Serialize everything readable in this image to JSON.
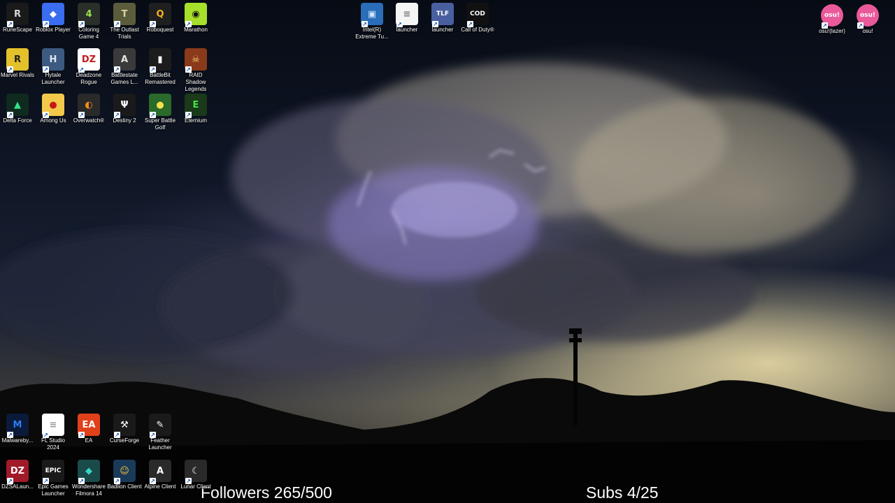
{
  "desktop": {
    "wallpaper": "storm-cloud-lightning",
    "icons_top_left": [
      {
        "name": "RuneScape",
        "bg": "#1a1a1a",
        "fg": "#d8d8d8",
        "glyph": "R",
        "icon": "runescape-icon"
      },
      {
        "name": "Roblox Player",
        "bg": "#3a6df0",
        "fg": "#ffffff",
        "glyph": "◆",
        "icon": "roblox-icon"
      },
      {
        "name": "Coloring Game 4",
        "bg": "#2a2f2a",
        "fg": "#9be04b",
        "glyph": "4",
        "icon": "coloring-game-icon"
      },
      {
        "name": "The Outlast Trials",
        "bg": "#5b5c3b",
        "fg": "#d9d3a0",
        "glyph": "T",
        "icon": "outlast-trials-icon"
      },
      {
        "name": "Roboquest",
        "bg": "#1f1f1f",
        "fg": "#f5b321",
        "glyph": "Q",
        "icon": "roboquest-icon"
      },
      {
        "name": "Marathon",
        "bg": "#a6e02a",
        "fg": "#111111",
        "glyph": "◉",
        "icon": "marathon-icon"
      },
      {
        "name": "Marvel Rivals",
        "bg": "#e3c12a",
        "fg": "#1a1a1a",
        "glyph": "R",
        "icon": "marvel-rivals-icon"
      },
      {
        "name": "Hytale Launcher",
        "bg": "#3d5a80",
        "fg": "#dfe7f5",
        "glyph": "H",
        "icon": "hytale-icon"
      },
      {
        "name": "Deadzone Rogue",
        "bg": "#ffffff",
        "fg": "#c01a1a",
        "glyph": "DZ",
        "icon": "deadzone-rogue-icon"
      },
      {
        "name": "Battlestate Games L...",
        "bg": "#3a3a3a",
        "fg": "#e5e5e5",
        "glyph": "A",
        "icon": "battlestate-icon"
      },
      {
        "name": "BattleBit Remastered",
        "bg": "#1c1c1c",
        "fg": "#ffffff",
        "glyph": "▮",
        "icon": "battlebit-icon"
      },
      {
        "name": "RAID Shadow Legends",
        "bg": "#8a3a1a",
        "fg": "#f2c46b",
        "glyph": "☠",
        "icon": "raid-shadow-legends-icon"
      },
      {
        "name": "Delta Force",
        "bg": "#0f2a1f",
        "fg": "#35e28a",
        "glyph": "▲",
        "icon": "delta-force-icon"
      },
      {
        "name": "Among Us",
        "bg": "#f3c94a",
        "fg": "#c41a1a",
        "glyph": "●",
        "icon": "among-us-icon"
      },
      {
        "name": "Overwatch®",
        "bg": "#2a2a2a",
        "fg": "#f28c1c",
        "glyph": "◐",
        "icon": "overwatch-icon"
      },
      {
        "name": "Destiny 2",
        "bg": "#1a1a1a",
        "fg": "#ffffff",
        "glyph": "Ψ",
        "icon": "destiny-2-icon"
      },
      {
        "name": "Super Battle Golf",
        "bg": "#2a6a2a",
        "fg": "#f6e24a",
        "glyph": "●",
        "icon": "super-battle-golf-icon"
      },
      {
        "name": "Eternium",
        "bg": "#1a3a1a",
        "fg": "#45e34a",
        "glyph": "E",
        "icon": "eternium-icon"
      }
    ],
    "icons_top_center": [
      {
        "name": "Intel(R) Extreme Tu...",
        "bg": "#2a6db8",
        "fg": "#cfe6ff",
        "glyph": "▣",
        "icon": "intel-xtu-icon"
      },
      {
        "name": "launcher",
        "bg": "#f4f4f4",
        "fg": "#7a7a7a",
        "glyph": "≡",
        "icon": "file-icon"
      },
      {
        "name": "launcher",
        "bg": "#4a5fa0",
        "fg": "#ffffff",
        "glyph": "TLF",
        "icon": "tlf-launcher-icon"
      },
      {
        "name": "Call of Duty®",
        "bg": "#111111",
        "fg": "#ffffff",
        "glyph": "COD",
        "icon": "call-of-duty-icon"
      }
    ],
    "icons_top_right": [
      {
        "name": "osu!(lazer)",
        "bg": "#ea5a9a",
        "fg": "#ffffff",
        "glyph": "osu!",
        "icon": "osu-lazer-icon"
      },
      {
        "name": "osu!",
        "bg": "#ea5a9a",
        "fg": "#ffffff",
        "glyph": "osu!",
        "icon": "osu-icon"
      }
    ],
    "icons_bottom_left": [
      {
        "name": "Malwareby...",
        "bg": "#0b1a3a",
        "fg": "#2a7cf0",
        "glyph": "M",
        "icon": "malwarebytes-icon"
      },
      {
        "name": "FL Studio 2024",
        "bg": "#ffffff",
        "fg": "#9a9a9a",
        "glyph": "≡",
        "icon": "fl-studio-icon"
      },
      {
        "name": "EA",
        "bg": "#e0401a",
        "fg": "#ffffff",
        "glyph": "EA",
        "icon": "ea-icon"
      },
      {
        "name": "CurseForge",
        "bg": "#1a1a1a",
        "fg": "#ffffff",
        "glyph": "⚒",
        "icon": "curseforge-icon"
      },
      {
        "name": "Feather Launcher",
        "bg": "#1a1a1a",
        "fg": "#ffffff",
        "glyph": "✎",
        "icon": "feather-launcher-icon"
      },
      {
        "name": "DZSALaun...",
        "bg": "#a01a2a",
        "fg": "#ffffff",
        "glyph": "DZ",
        "icon": "dzsa-launcher-icon"
      },
      {
        "name": "Epic Games Launcher",
        "bg": "#1a1a1a",
        "fg": "#ffffff",
        "glyph": "EPIC",
        "icon": "epic-games-icon"
      },
      {
        "name": "Wondershare Filmora 14",
        "bg": "#1a4a4a",
        "fg": "#35d6c4",
        "glyph": "◆",
        "icon": "filmora-icon"
      },
      {
        "name": "Badlion Client",
        "bg": "#1a3a5a",
        "fg": "#f2c43a",
        "glyph": "☺",
        "icon": "badlion-client-icon"
      },
      {
        "name": "Alpine Client",
        "bg": "#2a2a2a",
        "fg": "#ffffff",
        "glyph": "A",
        "icon": "alpine-client-icon"
      },
      {
        "name": "Lunar Client",
        "bg": "#2a2a2a",
        "fg": "#ffffff",
        "glyph": "☾",
        "icon": "lunar-client-icon"
      }
    ]
  },
  "stream_overlay": {
    "followers_text": "Followers 265/500",
    "subs_text": "Subs 4/25"
  }
}
